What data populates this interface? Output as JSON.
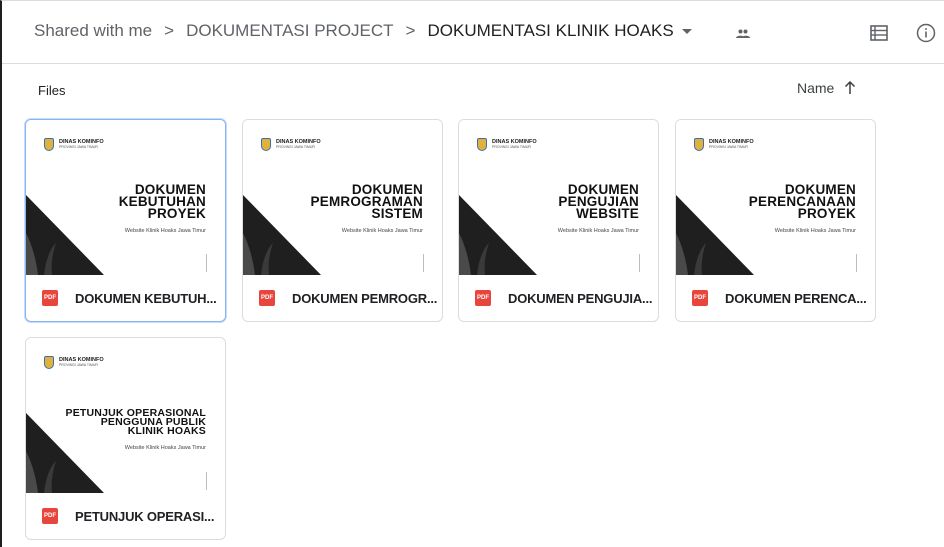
{
  "breadcrumb": {
    "items": [
      "Shared with me",
      "DOKUMENTASI PROJECT",
      "DOKUMENTASI KLINIK HOAKS"
    ],
    "separator": ">"
  },
  "section_label": "Files",
  "sort": {
    "label": "Name"
  },
  "files": [
    {
      "name": "DOKUMEN KEBUTUH...",
      "thumb_org": "DINAS KOMINFO",
      "thumb_org_sub": "PROVINSI JAWA TIMUR",
      "thumb_title": [
        "DOKUMEN",
        "KEBUTUHAN",
        "PROYEK"
      ],
      "thumb_subtitle": "Website Klinik Hoaks Jawa Timur",
      "file_type": "PDF"
    },
    {
      "name": "DOKUMEN PEMROGR...",
      "thumb_org": "DINAS KOMINFO",
      "thumb_org_sub": "PROVINSI JAWA TIMUR",
      "thumb_title": [
        "DOKUMEN",
        "PEMROGRAMAN",
        "SISTEM"
      ],
      "thumb_subtitle": "Website Klinik Hoaks Jawa Timur",
      "file_type": "PDF"
    },
    {
      "name": "DOKUMEN PENGUJIA...",
      "thumb_org": "DINAS KOMINFO",
      "thumb_org_sub": "PROVINSI JAWA TIMUR",
      "thumb_title": [
        "DOKUMEN",
        "PENGUJIAN",
        "WEBSITE"
      ],
      "thumb_subtitle": "Website Klinik Hoaks Jawa Timur",
      "file_type": "PDF"
    },
    {
      "name": "DOKUMEN PERENCA...",
      "thumb_org": "DINAS KOMINFO",
      "thumb_org_sub": "PROVINSI JAWA TIMUR",
      "thumb_title": [
        "DOKUMEN",
        "PERENCANAAN",
        "PROYEK"
      ],
      "thumb_subtitle": "Website Klinik Hoaks Jawa Timur",
      "file_type": "PDF"
    },
    {
      "name": "PETUNJUK OPERASI...",
      "thumb_org": "DINAS KOMINFO",
      "thumb_org_sub": "PROVINSI JAWA TIMUR",
      "thumb_title": [
        "PETUNJUK OPERASIONAL",
        "PENGGUNA PUBLIK",
        "KLINIK HOAKS"
      ],
      "thumb_subtitle": "Website Klinik Hoaks Jawa Timur",
      "file_type": "PDF"
    }
  ],
  "icons": {
    "shared": "people-icon",
    "view": "list-view-icon",
    "details": "info-icon",
    "file": "pdf-icon",
    "sort_direction": "arrow-up-icon"
  },
  "colors": {
    "pdf": "#e8453c",
    "selected_border": "#8ab4f8",
    "border": "#dadce0"
  }
}
